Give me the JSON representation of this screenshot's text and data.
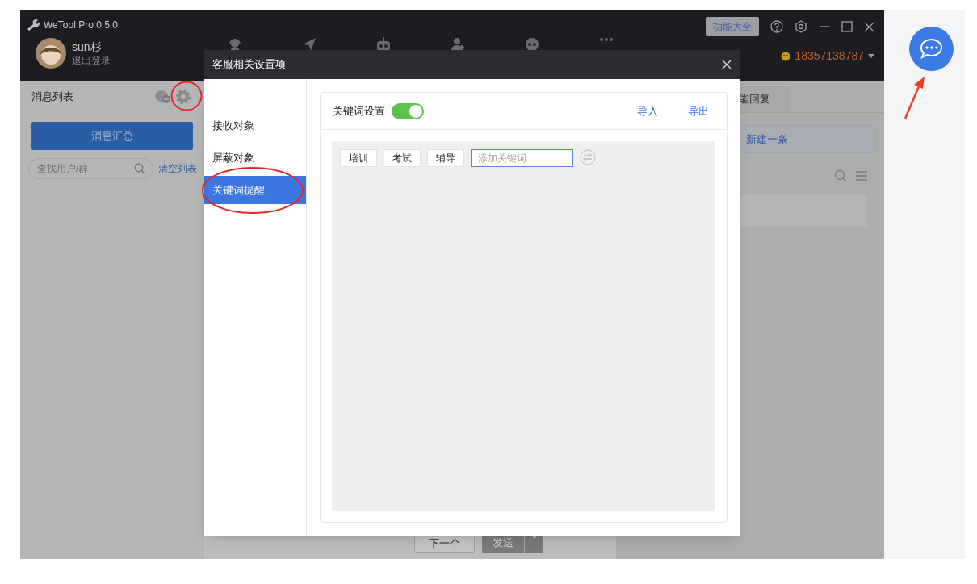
{
  "window": {
    "title": "WeTool Pro 0.5.0"
  },
  "user": {
    "name": "sun杉",
    "logout": "退出登录"
  },
  "toolbar": {
    "feature_button": "功能大全",
    "account_phone": "18357138787"
  },
  "left_panel": {
    "title": "消息列表",
    "summary_button": "消息汇总",
    "search": {
      "placeholder": "查找用户/群"
    },
    "clear_link": "清空列表"
  },
  "right_panel": {
    "tab": "能回复",
    "new_button": "新建一条"
  },
  "composer": {
    "next_button": "下一个",
    "send_button": "发送"
  },
  "dialog": {
    "title": "客服相关设置项",
    "menu": [
      {
        "label": "接收对象",
        "selected": false
      },
      {
        "label": "屏蔽对象",
        "selected": false
      },
      {
        "label": "关键词提醒",
        "selected": true
      }
    ],
    "keyword_settings": {
      "label": "关键词设置",
      "enabled": true,
      "import_link": "导入",
      "export_link": "导出",
      "keywords": [
        "培训",
        "考试",
        "辅导"
      ],
      "input": {
        "placeholder": "添加关键词"
      }
    }
  }
}
